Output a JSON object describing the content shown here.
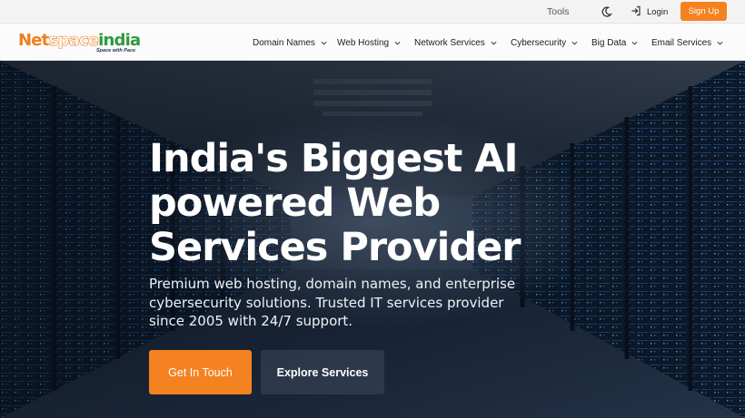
{
  "topbar": {
    "tools_label": "Tools",
    "login_label": "Login",
    "signup_label": "Sign Up",
    "theme_icon": "moon-icon",
    "login_icon": "login-icon"
  },
  "logo": {
    "part1": "Net",
    "part2": "space",
    "part3": "india",
    "tagline": "Space with Pace"
  },
  "nav": {
    "items": [
      {
        "label": "Domain Names"
      },
      {
        "label": "Web Hosting"
      },
      {
        "label": "Network Services"
      },
      {
        "label": "Cybersecurity"
      },
      {
        "label": "Big Data"
      },
      {
        "label": "Email Services"
      }
    ],
    "dropdown_icon": "chevron-down-icon"
  },
  "hero": {
    "headline_line1": "India's Biggest AI",
    "headline_line2": "powered Web",
    "headline_line3": "Services Provider",
    "subtext_line1": "Premium web hosting, domain names, and enterprise",
    "subtext_line2": "cybersecurity solutions. Trusted IT services provider",
    "subtext_line3": "since 2005 with 24/7 support.",
    "primary_button": "Get In Touch",
    "secondary_button": "Explore Services"
  },
  "colors": {
    "accent": "#f58220",
    "logo_orange": "#f07f1b",
    "logo_green": "#2e9a3c",
    "hero_dark": "#0c1522"
  }
}
